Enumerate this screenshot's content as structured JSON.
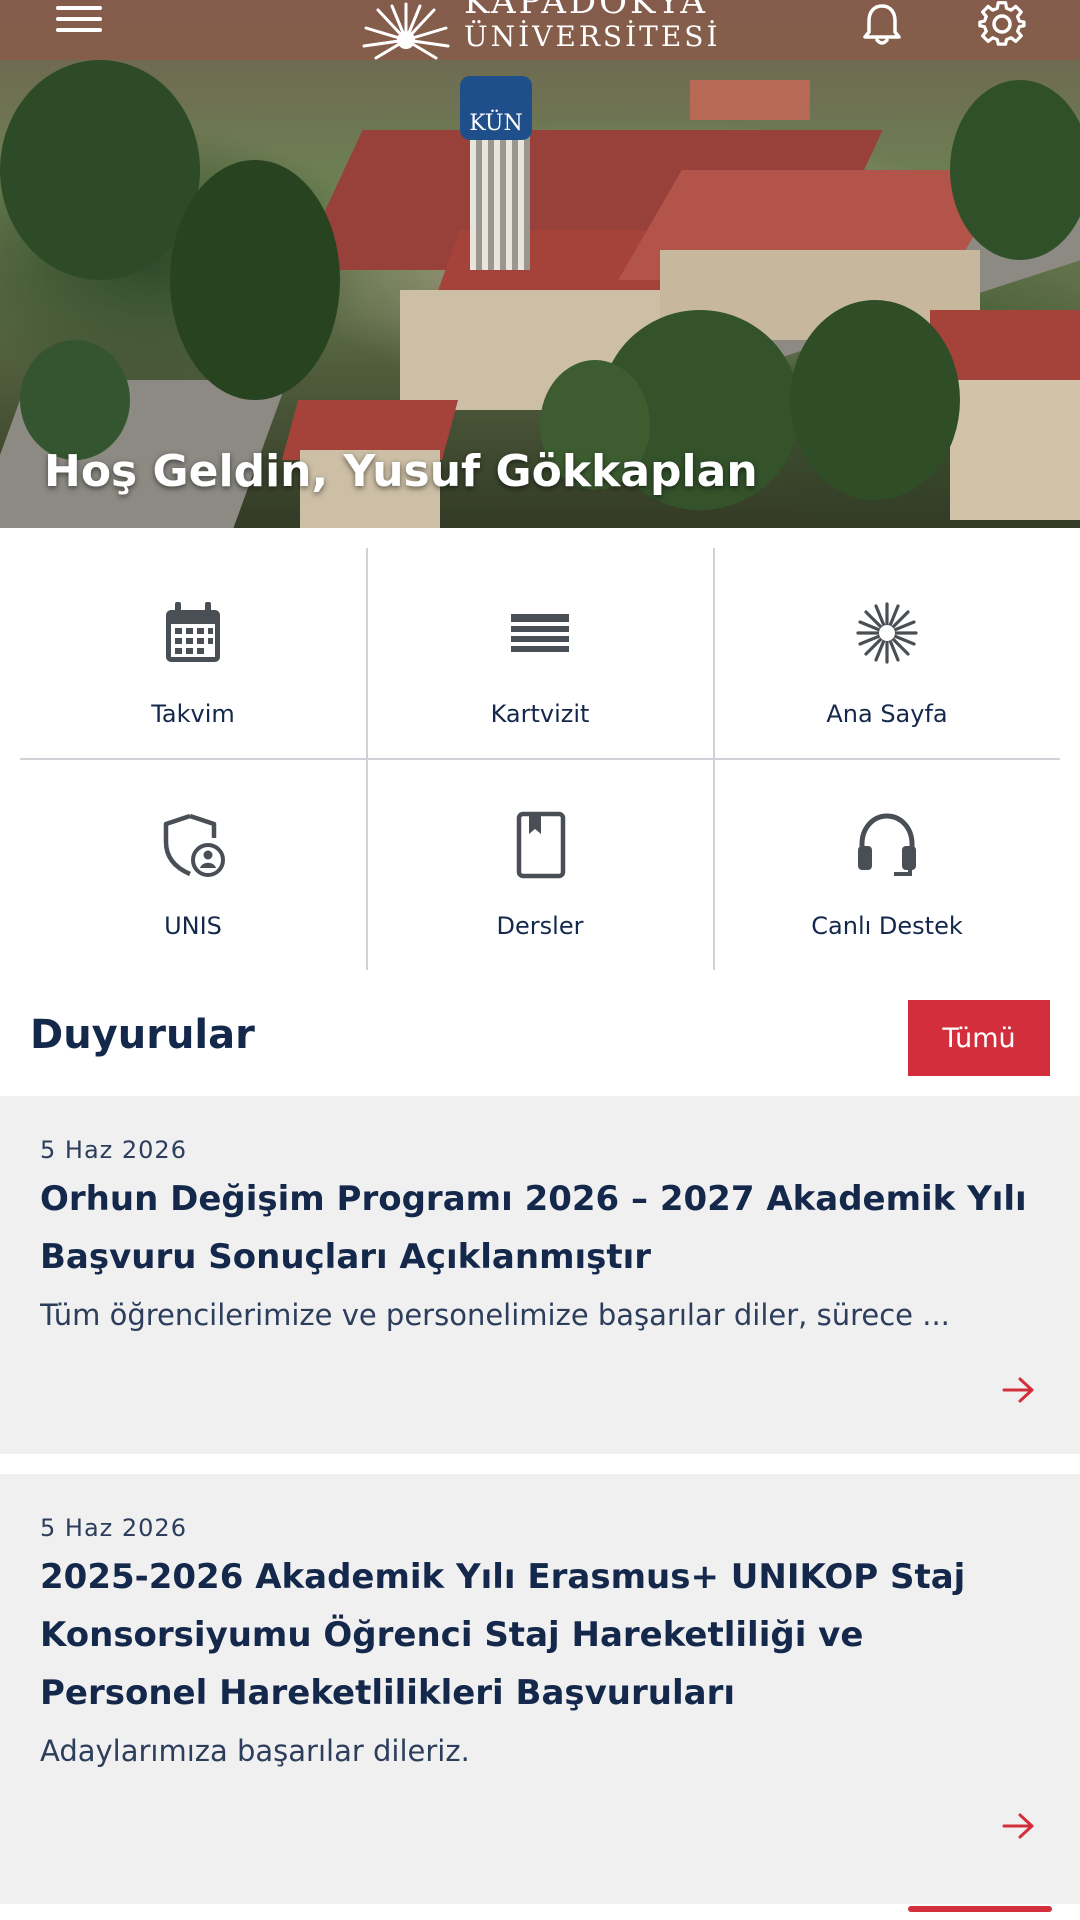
{
  "header": {
    "logo_line1": "KAPADOKYA",
    "logo_line2": "ÜNİVERSİTESİ",
    "tower_label": "KÜN",
    "welcome": "Hoş Geldin, Yusuf Gökkaplan"
  },
  "quick_links": [
    {
      "label": "Takvim",
      "icon": "calendar-icon"
    },
    {
      "label": "Kartvizit",
      "icon": "card-lines-icon"
    },
    {
      "label": "Ana Sayfa",
      "icon": "university-logo-icon"
    },
    {
      "label": "UNIS",
      "icon": "shield-user-icon"
    },
    {
      "label": "Dersler",
      "icon": "book-icon"
    },
    {
      "label": "Canlı Destek",
      "icon": "headset-icon"
    }
  ],
  "announcements": {
    "title": "Duyurular",
    "all_label": "Tümü",
    "items": [
      {
        "date": "5 Haz 2026",
        "title": "Orhun Değişim Programı 2026 – 2027 Akademik Yılı Başvuru Sonuçları Açıklanmıştır",
        "desc": "Tüm öğrencilerimize ve personelimize başarılar diler, sürece ..."
      },
      {
        "date": "5 Haz 2026",
        "title": "2025-2026 Akademik Yılı Erasmus+ UNIKOP Staj Konsorsiyumu Öğrenci Staj Hareketliliği ve Personel Hareketlilikleri Başvuruları",
        "desc": "Adaylarımıza başarılar dileriz."
      }
    ]
  },
  "colors": {
    "accent": "#d32e3b",
    "navy": "#14284b",
    "card_bg": "#f0f0f0",
    "divider": "#cfd3d8"
  }
}
